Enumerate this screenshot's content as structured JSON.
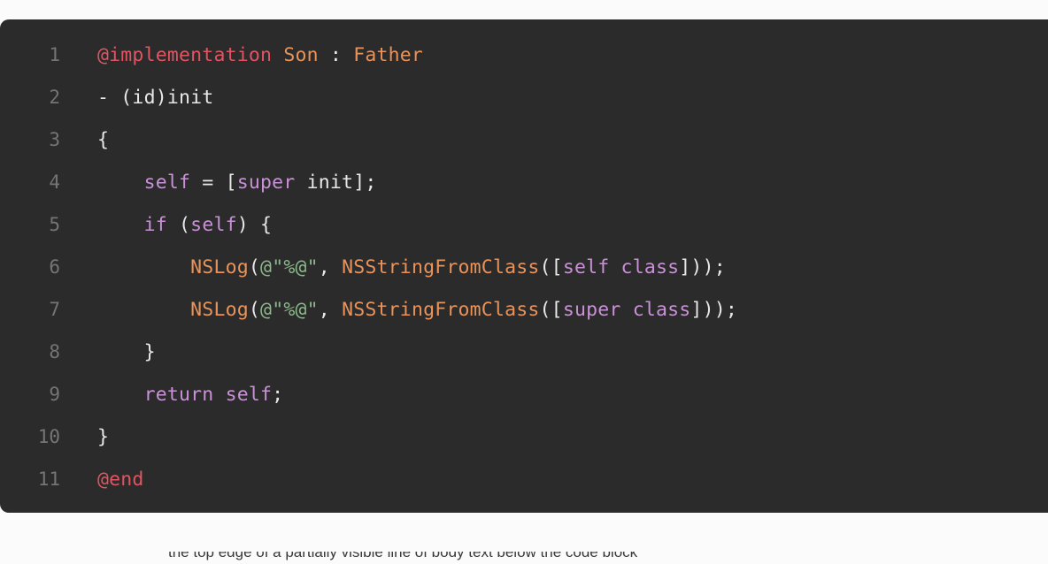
{
  "page": {
    "background_color": "#fbfbfb"
  },
  "code_block": {
    "background_color": "#2b2b2b",
    "language": "objective-c",
    "line_number_color": "#757575",
    "colors": {
      "keyword": "#e05561",
      "type": "#e8935b",
      "lang_keyword": "#c991d6",
      "string": "#8ab98a",
      "plain": "#e8e8e8"
    },
    "lines": [
      {
        "number": "1",
        "tokens": [
          {
            "text": "@implementation",
            "kind": "keyword"
          },
          {
            "text": " ",
            "kind": "plain"
          },
          {
            "text": "Son",
            "kind": "type"
          },
          {
            "text": " : ",
            "kind": "plain"
          },
          {
            "text": "Father",
            "kind": "type"
          }
        ]
      },
      {
        "number": "2",
        "tokens": [
          {
            "text": "- (id)init",
            "kind": "plain"
          }
        ]
      },
      {
        "number": "3",
        "tokens": [
          {
            "text": "{",
            "kind": "plain"
          }
        ]
      },
      {
        "number": "4",
        "tokens": [
          {
            "text": "    ",
            "kind": "plain"
          },
          {
            "text": "self",
            "kind": "lang_keyword"
          },
          {
            "text": " = [",
            "kind": "plain"
          },
          {
            "text": "super",
            "kind": "lang_keyword"
          },
          {
            "text": " init];",
            "kind": "plain"
          }
        ]
      },
      {
        "number": "5",
        "tokens": [
          {
            "text": "    ",
            "kind": "plain"
          },
          {
            "text": "if",
            "kind": "lang_keyword"
          },
          {
            "text": " (",
            "kind": "plain"
          },
          {
            "text": "self",
            "kind": "lang_keyword"
          },
          {
            "text": ") {",
            "kind": "plain"
          }
        ]
      },
      {
        "number": "6",
        "tokens": [
          {
            "text": "        ",
            "kind": "plain"
          },
          {
            "text": "NSLog",
            "kind": "type"
          },
          {
            "text": "(",
            "kind": "plain"
          },
          {
            "text": "@\"%@\"",
            "kind": "string"
          },
          {
            "text": ", ",
            "kind": "plain"
          },
          {
            "text": "NSStringFromClass",
            "kind": "type"
          },
          {
            "text": "([",
            "kind": "plain"
          },
          {
            "text": "self class",
            "kind": "lang_keyword"
          },
          {
            "text": "]));",
            "kind": "plain"
          }
        ]
      },
      {
        "number": "7",
        "tokens": [
          {
            "text": "        ",
            "kind": "plain"
          },
          {
            "text": "NSLog",
            "kind": "type"
          },
          {
            "text": "(",
            "kind": "plain"
          },
          {
            "text": "@\"%@\"",
            "kind": "string"
          },
          {
            "text": ", ",
            "kind": "plain"
          },
          {
            "text": "NSStringFromClass",
            "kind": "type"
          },
          {
            "text": "([",
            "kind": "plain"
          },
          {
            "text": "super class",
            "kind": "lang_keyword"
          },
          {
            "text": "]));",
            "kind": "plain"
          }
        ]
      },
      {
        "number": "8",
        "tokens": [
          {
            "text": "    }",
            "kind": "plain"
          }
        ]
      },
      {
        "number": "9",
        "tokens": [
          {
            "text": "    ",
            "kind": "plain"
          },
          {
            "text": "return self",
            "kind": "lang_keyword"
          },
          {
            "text": ";",
            "kind": "plain"
          }
        ]
      },
      {
        "number": "10",
        "tokens": [
          {
            "text": "}",
            "kind": "plain"
          }
        ]
      },
      {
        "number": "11",
        "tokens": [
          {
            "text": "@end",
            "kind": "keyword"
          }
        ]
      }
    ]
  },
  "bottom_clipped_line": {
    "text": "the top edge of a partially visible line of body text below the code block"
  }
}
